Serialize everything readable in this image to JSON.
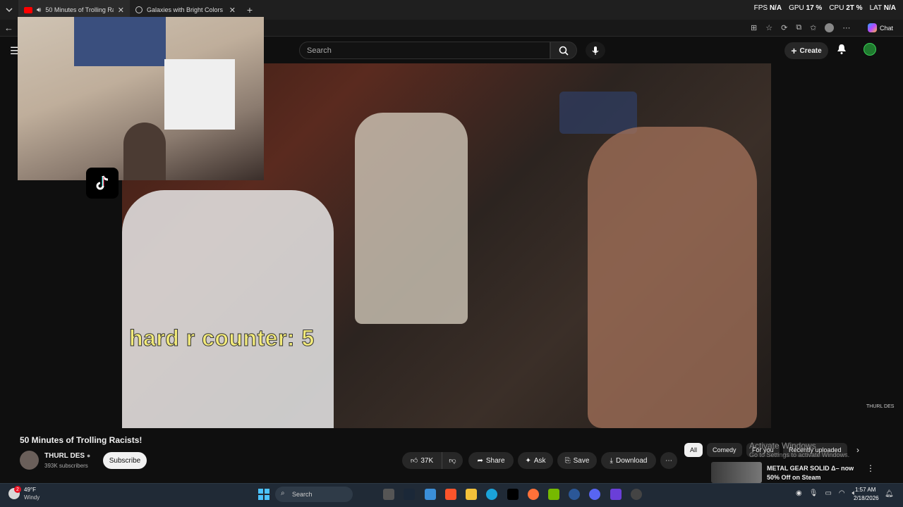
{
  "browser": {
    "tabs": [
      {
        "label": "50 Minutes of Trolling Racists",
        "icon": "youtube-icon",
        "active": true
      },
      {
        "label": "Galaxies with Bright Colors",
        "icon": "globe-icon",
        "active": false
      }
    ],
    "new_tab_label": "+",
    "stats": {
      "fps_label": "FPS",
      "fps_value": "N/A",
      "gpu_label": "GPU",
      "gpu_value": "17 %",
      "cpu_label": "CPU",
      "cpu_value": "2T %",
      "lat_label": "LAT",
      "lat_value": "N/A"
    },
    "chat_label": "Chat"
  },
  "youtube": {
    "search_placeholder": "Search",
    "create_label": "Create",
    "overlay_caption": "hard r counter: 5",
    "watermark": "THURL DES",
    "video_title": "50 Minutes of Trolling Racists!",
    "channel_name": "THURL DES",
    "subscribers": "393K subscribers",
    "subscribe_label": "Subscribe",
    "likes": "37K",
    "share_label": "Share",
    "ask_label": "Ask",
    "save_label": "Save",
    "download_label": "Download",
    "chips": [
      "All",
      "Comedy",
      "For you",
      "Recently uploaded"
    ],
    "recommendation_title": "METAL GEAR SOLID Δ– now 50% Off on Steam"
  },
  "windows": {
    "activate_title": "Activate Windows",
    "activate_sub": "Go to Settings to activate Windows.",
    "weather_temp": "49°F",
    "weather_desc": "Windy",
    "weather_badge": "2",
    "taskbar_search": "Search",
    "time": "1:57 AM",
    "date": "2/18/2026"
  },
  "colors": {
    "youtube_red": "#ff0000",
    "accent_yellow": "#f2ea7a",
    "taskbar": "#202a36"
  }
}
